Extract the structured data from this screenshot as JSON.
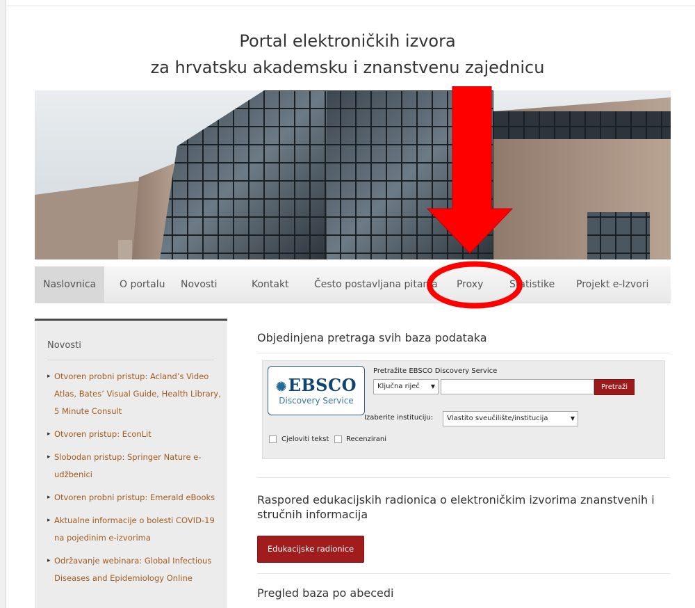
{
  "header": {
    "title_line1": "Portal elektroničkih izvora",
    "title_line2": "za hrvatsku akademsku i znanstvenu zajednicu"
  },
  "nav": {
    "items": [
      {
        "label": "Naslovnica",
        "active": true
      },
      {
        "label": "O portalu"
      },
      {
        "label": "Novosti"
      },
      {
        "label": "Kontakt"
      },
      {
        "label": "Često postavljana pitanja"
      },
      {
        "label": "Proxy"
      },
      {
        "label": "Statistike"
      },
      {
        "label": "Projekt e-Izvori"
      }
    ]
  },
  "sidebar": {
    "title": "Novosti",
    "items": [
      "Otvoren probni pristup: Acland’s Video Atlas, Bates’ Visual Guide, Health Library, 5 Minute Consult",
      "Otvoren pristup: EconLit",
      "Slobodan pristup: Springer Nature e-udžbenici",
      "Otvoren probni pristup: Emerald eBooks",
      "Aktualne informacije o bolesti COVID-19 na pojedinim e-izvorima",
      "Održavanje webinara: Global Infectious Diseases and Epidemiology Online"
    ]
  },
  "search": {
    "section_title": "Objedinjena pretraga svih baza podataka",
    "logo_brand": "EBSCO",
    "logo_sub": "Discovery Service",
    "caption": "Pretražite EBSCO Discovery Service",
    "field_select": "Ključna riječ",
    "input_value": "",
    "button": "Pretraži",
    "institution_label": "Izaberite instituciju:",
    "institution_select": "Vlastito sveučilište/institucija",
    "checkbox_fulltext": "Cjeloviti tekst",
    "checkbox_peer": "Recenzirani"
  },
  "education": {
    "title": "Raspored edukacijskih radionica o elektroničkim izvorima znanstvenih i stručnih informacija",
    "button": "Edukacijske radionice"
  },
  "alphabet": {
    "title": "Pregled baza po abecedi"
  },
  "annotation_color": "#ff0000"
}
